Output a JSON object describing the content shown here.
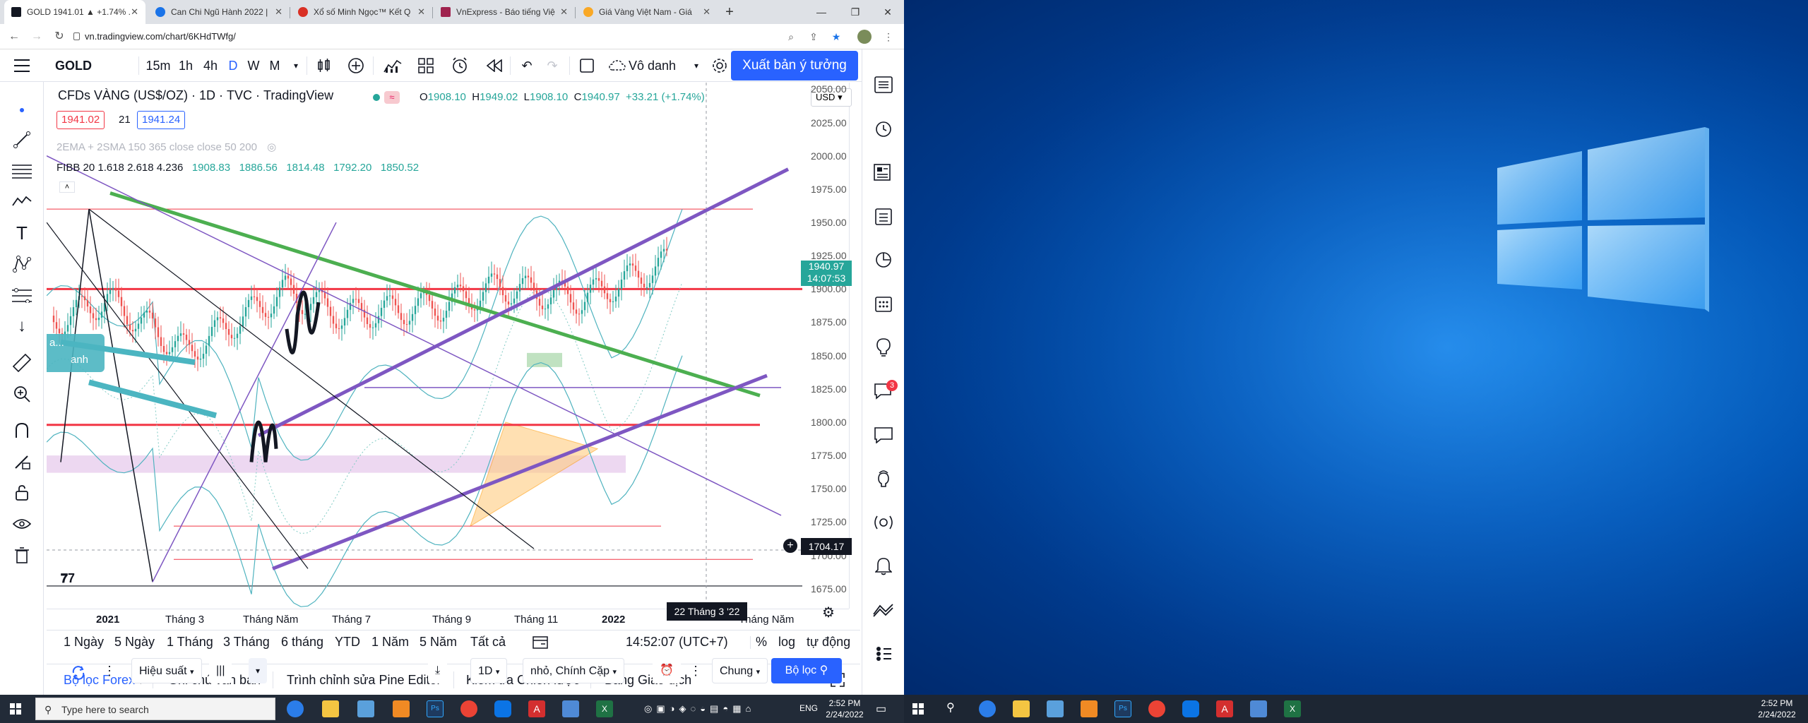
{
  "browser": {
    "tabs": [
      {
        "label": "GOLD 1941.01 ▲ +1.74% ...",
        "color": "#131722"
      },
      {
        "label": "Can Chi Ngũ Hành 2022 |",
        "color": "#1a73e8"
      },
      {
        "label": "Xổ số Minh Ngọc™ Kết Q",
        "color": "#d93025"
      },
      {
        "label": "VnExpress - Báo tiếng Việ",
        "color": "#9f224e"
      },
      {
        "label": "Giá Vàng Việt Nam - Giá",
        "color": "#f9a825"
      }
    ],
    "url": "vn.tradingview.com/chart/6KHdTWfg/"
  },
  "toolbar": {
    "symbol": "GOLD",
    "intervals": [
      "15m",
      "1h",
      "4h",
      "D",
      "W",
      "M"
    ],
    "active_interval": "D",
    "layout_name": "Vô danh",
    "publish_label": "Xuất bản ý tưởng"
  },
  "legend": {
    "title": "CFDs VÀNG (US$/OZ)",
    "interval": "1D",
    "source": "TVC",
    "provider": "TradingView",
    "o_label": "O",
    "o": "1908.10",
    "h_label": "H",
    "h": "1949.02",
    "l_label": "L",
    "l": "1908.10",
    "c_label": "C",
    "c": "1940.97",
    "change": "+33.21 (+1.74%)",
    "sell": "1941.02",
    "spread": "21",
    "buy": "1941.24",
    "ema_line": "2EMA + 2SMA 150 365 close close 50 200",
    "fibb_label": "FIBB 20 1.618 2.618 4.236",
    "fibb_values": [
      "1908.83",
      "1886.56",
      "1814.48",
      "1792.20",
      "1850.52"
    ],
    "currency": "USD",
    "last_price": "1940.97",
    "countdown": "14:07:53",
    "cursor_price": "1704.17",
    "cursor_date": "22 Tháng 3 '22",
    "left_label_1": "a...",
    "left_label_2": "anh"
  },
  "chart_data": {
    "type": "candlestick",
    "price_ticks": [
      "2050.00",
      "2025.00",
      "2000.00",
      "1975.00",
      "1950.00",
      "1925.00",
      "1900.00",
      "1875.00",
      "1850.00",
      "1825.00",
      "1800.00",
      "1775.00",
      "1750.00",
      "1725.00",
      "1700.00",
      "1675.00"
    ],
    "time_ticks": [
      "2021",
      "Tháng 3",
      "Tháng Năm",
      "Tháng 7",
      "Tháng 9",
      "Tháng 11",
      "2022",
      "Tháng Năm"
    ],
    "ylim": [
      1660,
      2055
    ]
  },
  "ranges": [
    "1 Ngày",
    "5 Ngày",
    "1 Tháng",
    "3 Tháng",
    "6 tháng",
    "YTD",
    "1 Năm",
    "5 Năm",
    "Tất cả"
  ],
  "status": {
    "time": "14:52:07 (UTC+7)",
    "percent": "%",
    "log": "log",
    "auto": "tự động"
  },
  "bottom_tabs": [
    "Bộ lọc Forex",
    "Ghi chú văn bản",
    "Trình chỉnh sửa Pine Editor",
    "Kiểm tra Chiến lược",
    "Bảng Giao dịch"
  ],
  "screener": {
    "performance": "Hiệu suất",
    "interval": "1D",
    "columns": "nhỏ, Chính Cặp",
    "general": "Chung",
    "filter": "Bộ lọc"
  },
  "right_panel": {
    "badge": "3"
  },
  "taskbar": {
    "search_placeholder": "Type here to search",
    "lang": "ENG",
    "time": "2:52 PM",
    "date": "2/24/2022"
  }
}
